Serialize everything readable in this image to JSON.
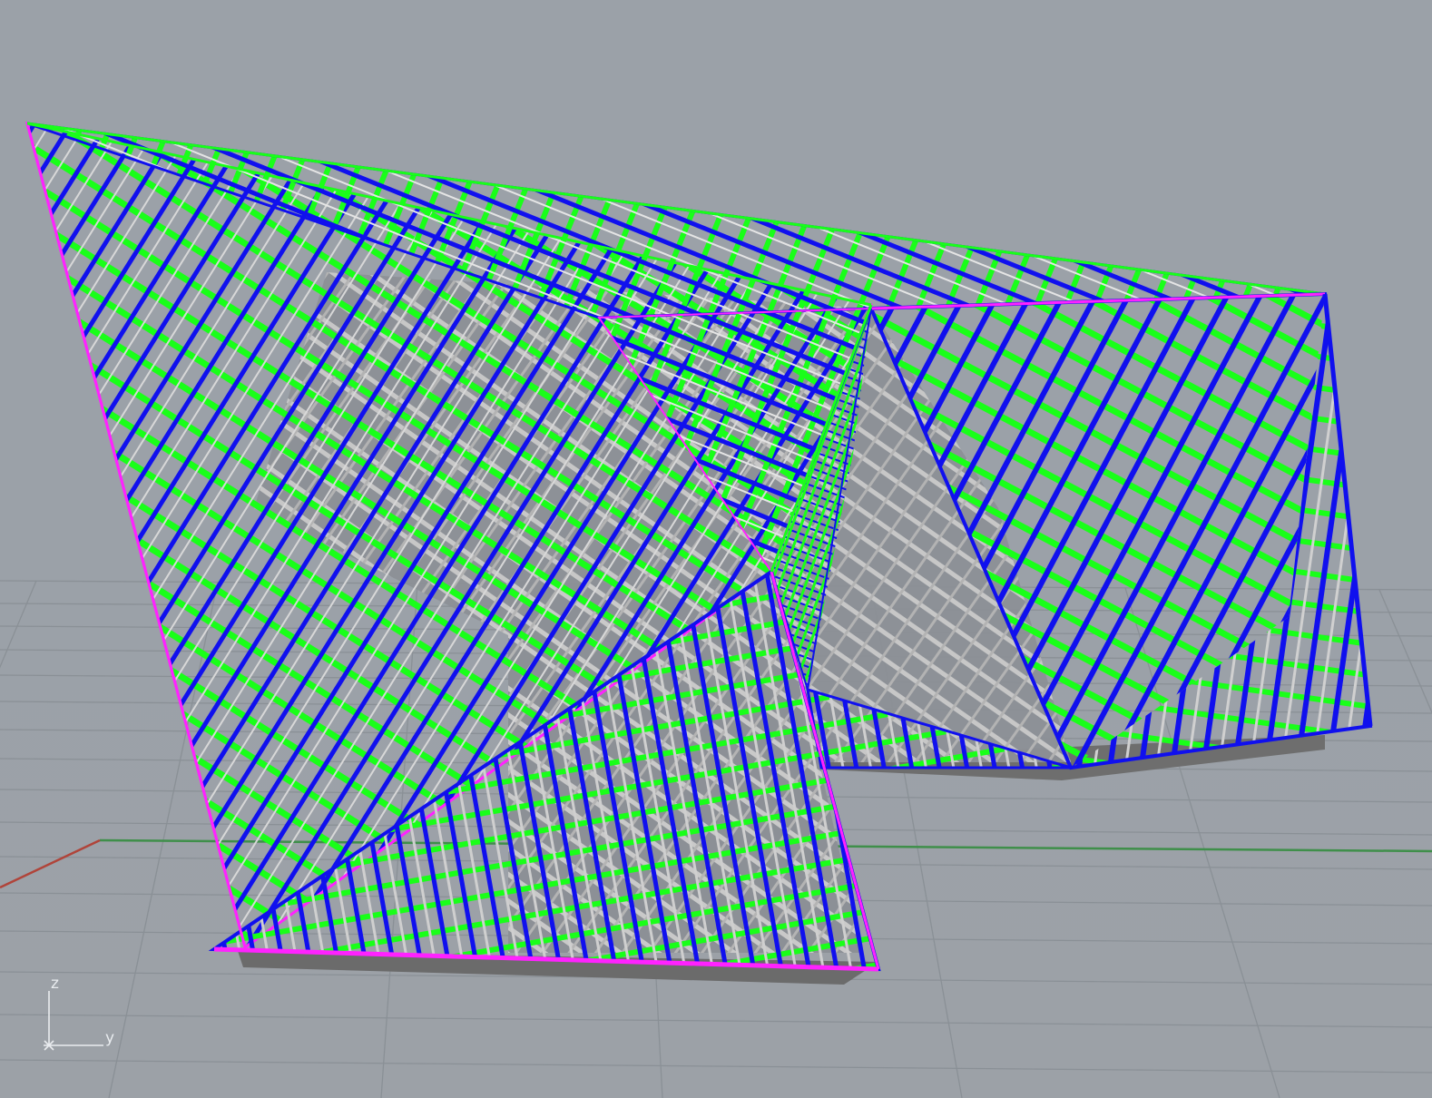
{
  "viewport": {
    "background": "#9ba1a8",
    "grid_color": "#8a8f95",
    "x_axis_color": "#b0443a",
    "y_axis_color": "#3f8f4a"
  },
  "model": {
    "colors": {
      "green": "#19ff19",
      "blue": "#1010ee",
      "magenta": "#ff22ff",
      "steel": "#c8c8c8",
      "base": "#6b6b6b"
    }
  },
  "axis_widget": {
    "z_label": "z",
    "y_label": "y"
  }
}
